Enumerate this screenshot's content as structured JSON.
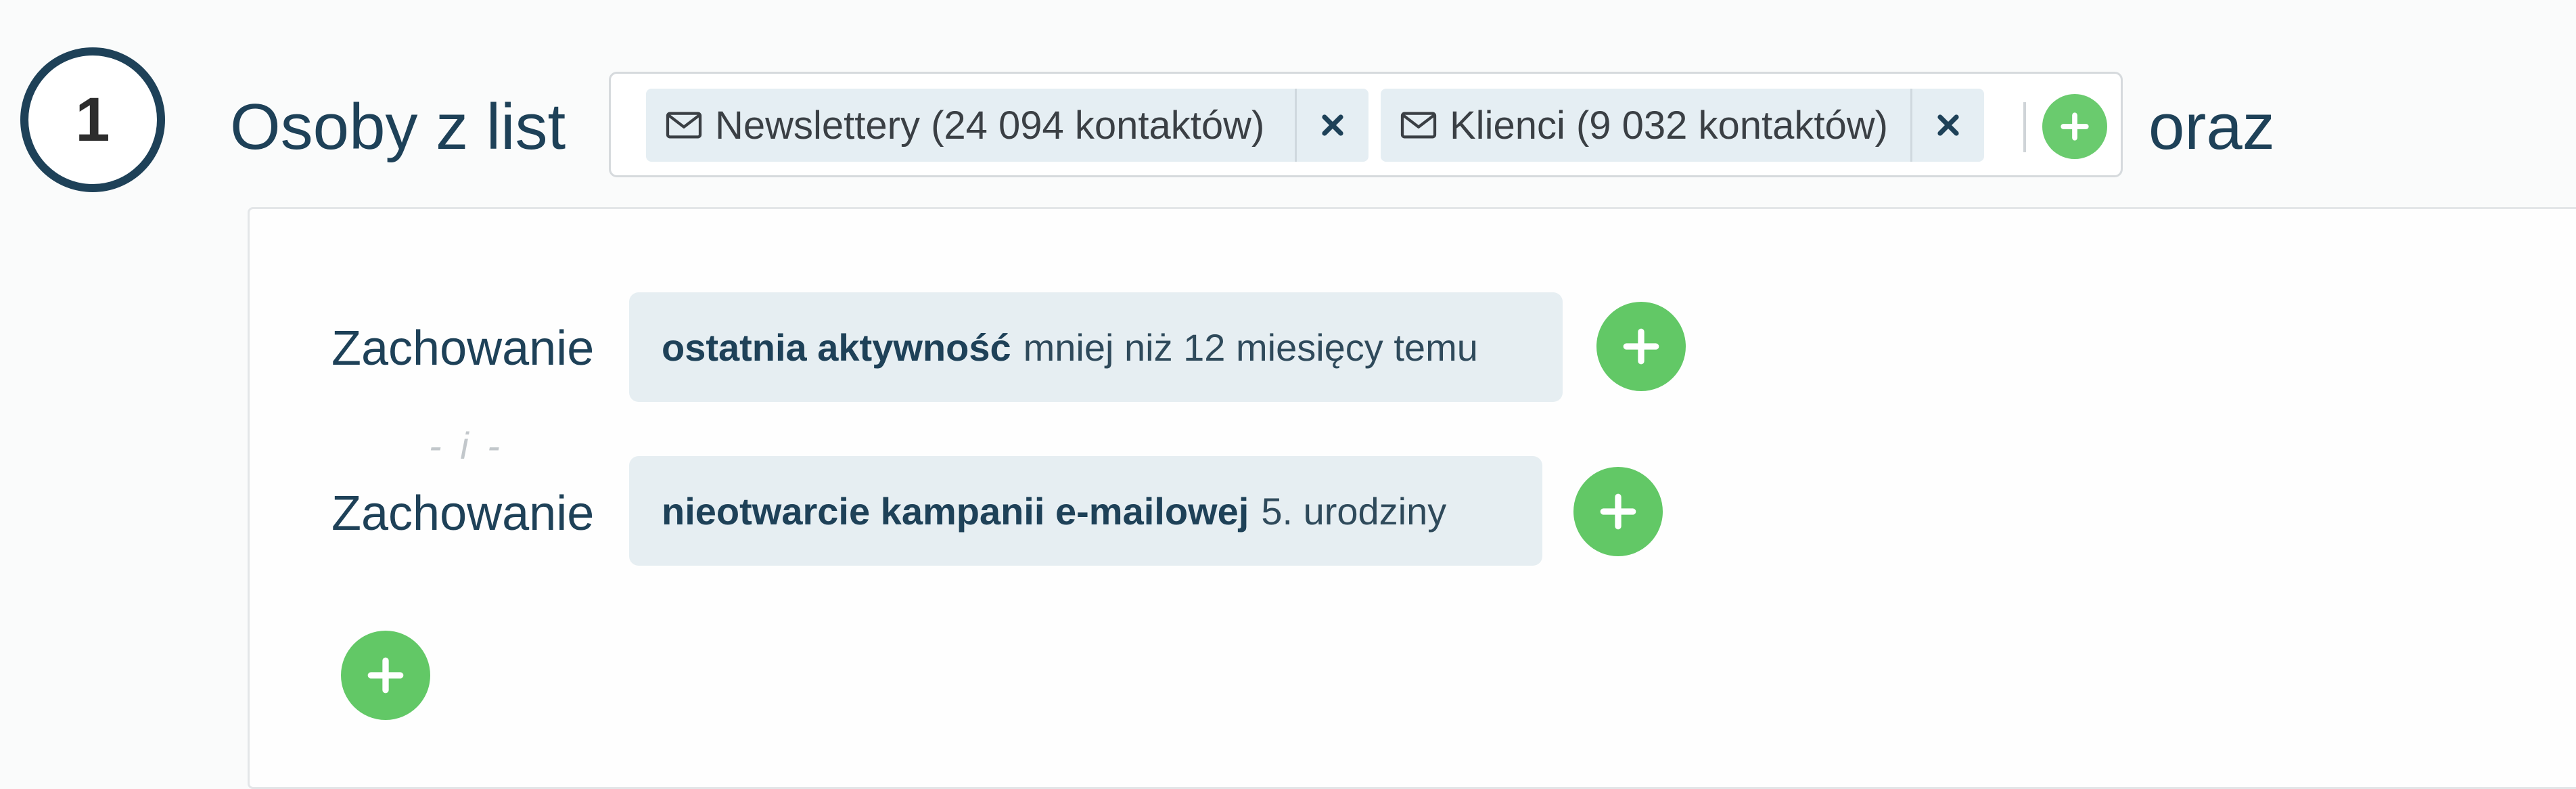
{
  "step": {
    "number": "1",
    "title": "Osoby z list"
  },
  "lists": {
    "tags": [
      {
        "label": "Newslettery (24 094 kontaktów)",
        "icon": "envelope-icon",
        "remove_icon": "close-icon"
      },
      {
        "label": "Klienci (9 032 kontaktów)",
        "icon": "envelope-icon",
        "remove_icon": "close-icon"
      }
    ],
    "add_icon": "plus-icon"
  },
  "connector": "oraz",
  "conditions": [
    {
      "type_label": "Zachowanie",
      "criterion": "ostatnia aktywność",
      "value": "mniej niż 12 miesięcy temu"
    },
    {
      "type_label": "Zachowanie",
      "criterion": "nieotwarcie kampanii e-mailowej",
      "value": "5. urodziny"
    }
  ],
  "separator": "- i -",
  "colors": {
    "primary": "#1e4158",
    "accent_green": "#62c866",
    "tag_background": "#e5eef3"
  }
}
